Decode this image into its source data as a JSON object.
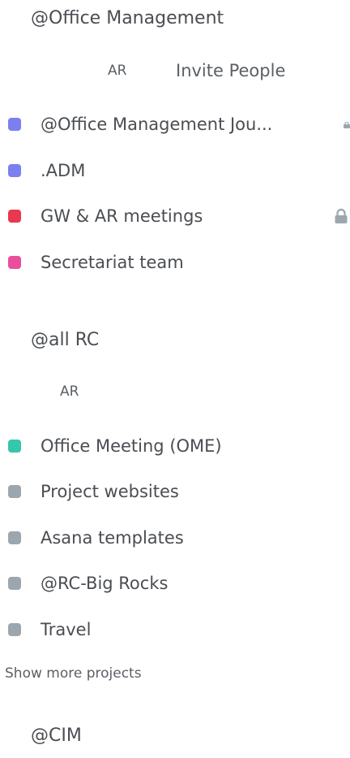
{
  "teams": [
    {
      "name": "@Office Management",
      "member_initials": "AR",
      "invite_label": "Invite People",
      "projects": [
        {
          "label": "@Office Management Jou...",
          "color": "#7b7ff0",
          "locked": true
        },
        {
          "label": ".ADM",
          "color": "#7b7ff0",
          "locked": false
        },
        {
          "label": "GW & AR meetings",
          "color": "#e8384f",
          "locked": true
        },
        {
          "label": "Secretariat team",
          "color": "#ea4e9d",
          "locked": false
        }
      ]
    },
    {
      "name": "@all RC",
      "member_initials": "AR",
      "projects": [
        {
          "label": "Office Meeting (OME)",
          "color": "#37c5ab",
          "locked": false
        },
        {
          "label": "Project websites",
          "color": "#9ca6af",
          "locked": false
        },
        {
          "label": "Asana templates",
          "color": "#9ca6af",
          "locked": false
        },
        {
          "label": "@RC-Big Rocks",
          "color": "#9ca6af",
          "locked": false
        },
        {
          "label": "Travel",
          "color": "#9ca6af",
          "locked": false
        }
      ],
      "show_more_label": "Show more projects"
    },
    {
      "name": "@CIM"
    }
  ],
  "icons": {
    "lock": "lock-icon"
  }
}
